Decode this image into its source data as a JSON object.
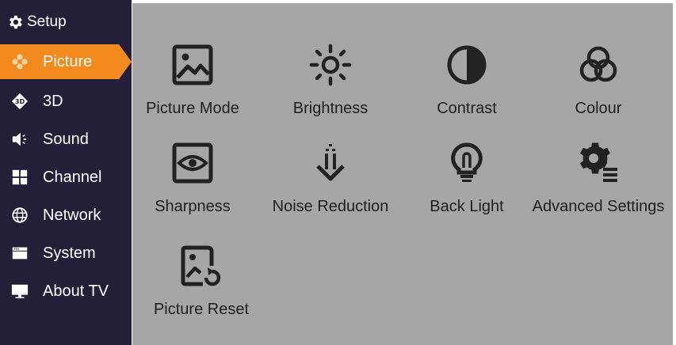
{
  "sidebar": {
    "title": "Setup",
    "items": [
      {
        "label": "Picture",
        "icon": "flower-icon",
        "active": true
      },
      {
        "label": "3D",
        "icon": "3d-icon"
      },
      {
        "label": "Sound",
        "icon": "speaker-icon"
      },
      {
        "label": "Channel",
        "icon": "grid-icon"
      },
      {
        "label": "Network",
        "icon": "globe-icon"
      },
      {
        "label": "System",
        "icon": "window-icon"
      },
      {
        "label": "About TV",
        "icon": "monitor-icon"
      }
    ]
  },
  "picture_menu": {
    "tiles": [
      {
        "label": "Picture Mode",
        "icon": "image-icon"
      },
      {
        "label": "Brightness",
        "icon": "sun-icon"
      },
      {
        "label": "Contrast",
        "icon": "contrast-icon"
      },
      {
        "label": "Colour",
        "icon": "color-circles-icon"
      },
      {
        "label": "Sharpness",
        "icon": "eye-icon"
      },
      {
        "label": "Noise Reduction",
        "icon": "noise-arrow-icon"
      },
      {
        "label": "Back Light",
        "icon": "bulb-icon"
      },
      {
        "label": "Advanced Settings",
        "icon": "gear-list-icon"
      },
      {
        "label": "Picture Reset",
        "icon": "image-reset-icon"
      }
    ]
  },
  "colors": {
    "sidebar_bg": "#241f38",
    "active_bg": "#f28a1e",
    "content_bg": "#a6a6a6",
    "icon_color": "#222222"
  }
}
